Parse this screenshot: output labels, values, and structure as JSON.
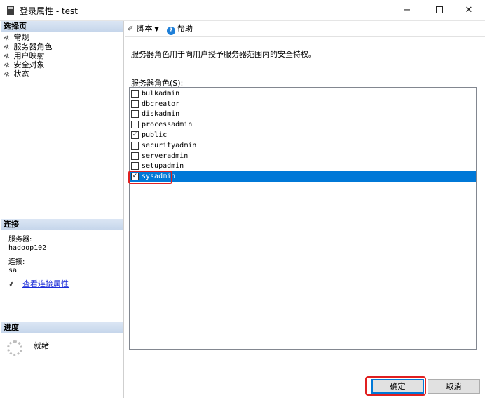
{
  "window": {
    "title": "登录属性 - test",
    "minimize": "−",
    "close": "✕"
  },
  "left": {
    "select_page_header": "选择页",
    "pages": [
      "常规",
      "服务器角色",
      "用户映射",
      "安全对象",
      "状态"
    ],
    "connection_header": "连接",
    "server_label": "服务器:",
    "server_value": "hadoop102",
    "connection_label": "连接:",
    "connection_value": "sa",
    "view_conn_link": "查看连接属性",
    "progress_header": "进度",
    "progress_status": "就绪"
  },
  "toolbar": {
    "script_label": "脚本",
    "help_label": "帮助"
  },
  "main": {
    "description": "服务器角色用于向用户授予服务器范围内的安全特权。",
    "roles_label": "服务器角色(S):",
    "roles": [
      {
        "name": "bulkadmin",
        "checked": false
      },
      {
        "name": "dbcreator",
        "checked": false
      },
      {
        "name": "diskadmin",
        "checked": false
      },
      {
        "name": "processadmin",
        "checked": false
      },
      {
        "name": "public",
        "checked": true
      },
      {
        "name": "securityadmin",
        "checked": false
      },
      {
        "name": "serveradmin",
        "checked": false
      },
      {
        "name": "setupadmin",
        "checked": false
      },
      {
        "name": "sysadmin",
        "checked": true,
        "selected": true
      }
    ]
  },
  "buttons": {
    "ok": "确定",
    "cancel": "取消"
  },
  "colors": {
    "selection": "#0078d7",
    "highlight_box": "#e02020",
    "link": "#1a2bd8"
  }
}
